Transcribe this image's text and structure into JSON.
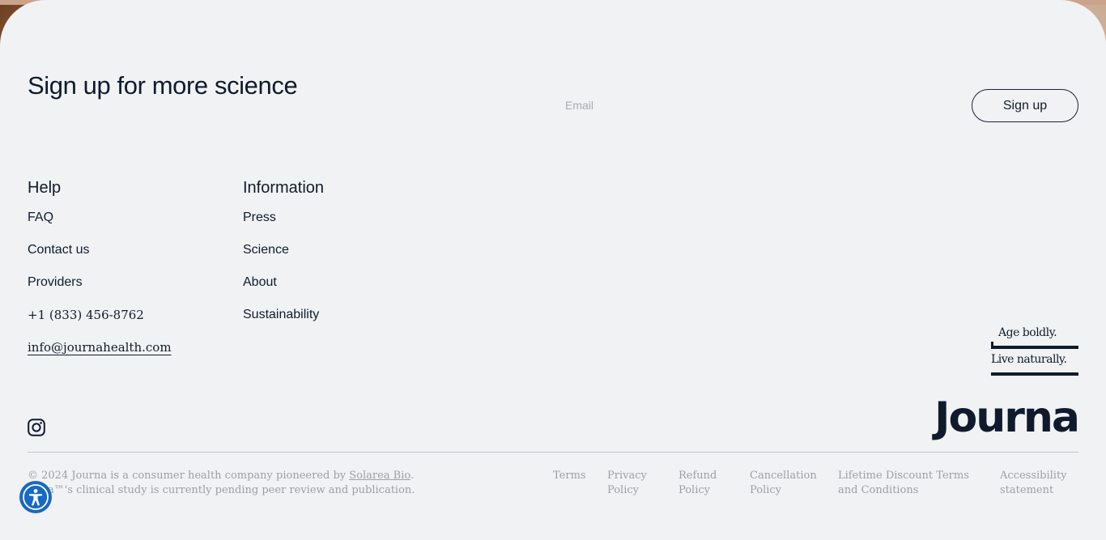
{
  "signup": {
    "title": "Sign up for more science",
    "email_placeholder": "Email",
    "button_label": "Sign up"
  },
  "help": {
    "heading": "Help",
    "links": [
      "FAQ",
      "Contact us",
      "Providers",
      "+1 (833) 456-8762",
      "info@journahealth.com"
    ]
  },
  "information": {
    "heading": "Information",
    "links": [
      "Press",
      "Science",
      "About",
      "Sustainability"
    ]
  },
  "brand": {
    "tagline_1": "Age boldly.",
    "tagline_2": "Live naturally.",
    "logo": "Journa"
  },
  "legal": {
    "line1_prefix": "© 2024 Journa is a consumer health company pioneered by ",
    "line1_link": "Solarea Bio",
    "line1_suffix": ".",
    "line2": "Solia™'s clinical study is currently pending peer review and publication."
  },
  "footer_links": {
    "terms": "Terms",
    "privacy": "Privacy Policy",
    "refund": "Refund Policy",
    "cancellation": "Cancellation Policy",
    "lifetime": "Lifetime Discount Terms and Conditions",
    "accessibility": "Accessibility statement"
  },
  "icons": {
    "social": "instagram-icon",
    "accessibility": "accessibility-icon"
  },
  "colors": {
    "text": "#0f1b2d",
    "background": "#f1f2f4",
    "muted": "#9b9fa6",
    "accessibility_button": "#1769c3"
  }
}
